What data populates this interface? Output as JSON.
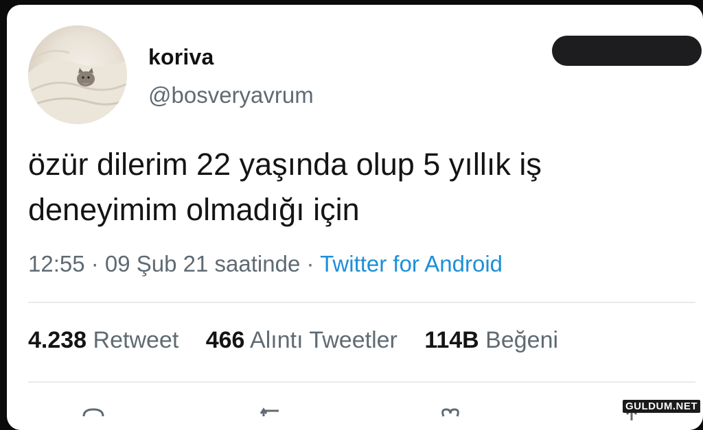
{
  "author": {
    "display_name": "koriva",
    "handle": "@bosveryavrum",
    "avatar_icon": "cat-on-blanket-avatar"
  },
  "tweet": {
    "line1": "özür dilerim 22 yaşında olup 5 yıllık iş",
    "line2": "deneyimim olmadığı için"
  },
  "meta": {
    "time": "12:55",
    "sep1": " · ",
    "date": "09 Şub 21 saatinde",
    "sep2": " · ",
    "source": "Twitter for Android"
  },
  "stats": {
    "retweets_count": "4.238",
    "retweets_label": "Retweet",
    "quotes_count": "466",
    "quotes_label": "Alıntı Tweetler",
    "likes_count": "114B",
    "likes_label": "Beğeni"
  },
  "actions": {
    "icons": [
      "reply-icon",
      "retweet-icon",
      "like-icon",
      "share-icon"
    ]
  },
  "watermark": "GULDUM.NET",
  "colors": {
    "link": "#1d8fd8",
    "muted": "#5f6a72",
    "text": "#141414",
    "background": "#ffffff"
  }
}
